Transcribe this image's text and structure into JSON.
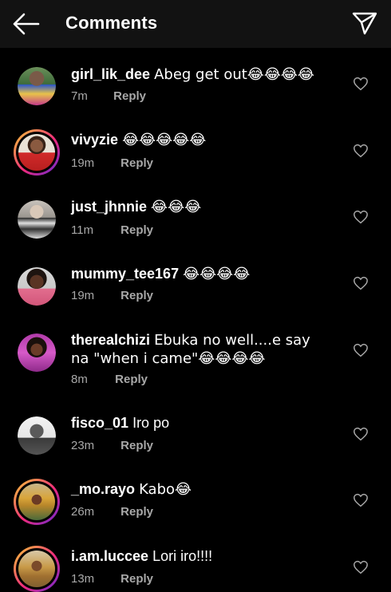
{
  "header": {
    "title": "Comments"
  },
  "reply_label": "Reply",
  "comments": [
    {
      "user": "girl_lik_dee",
      "text": "Abeg get out😂😂😂😂",
      "time": "7m"
    },
    {
      "user": "vivyzie",
      "text": "😂😂😂😂😂",
      "time": "19m"
    },
    {
      "user": "just_jhnnie",
      "text": "😂😂😂",
      "time": "11m"
    },
    {
      "user": "mummy_tee167",
      "text": "😂😂😂😂",
      "time": "19m"
    },
    {
      "user": "therealchizi",
      "text": "Ebuka no well....e say na \"when i came\"😂😂😂😂",
      "time": "8m"
    },
    {
      "user": "fisco_01",
      "text": "Iro po",
      "time": "23m"
    },
    {
      "user": "_mo.rayo",
      "text": "Kabo😂",
      "time": "26m"
    },
    {
      "user": "i.am.luccee",
      "text": "Lori iro!!!!",
      "time": "13m"
    }
  ],
  "colors": {
    "background": "#000000",
    "header": "#121212",
    "muted": "#a8a8a8"
  }
}
